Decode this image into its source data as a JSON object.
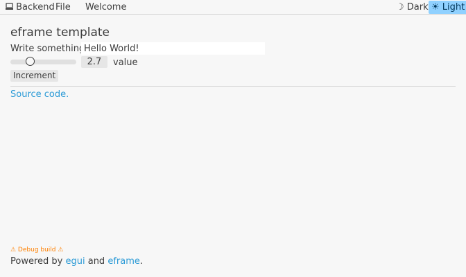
{
  "menu": {
    "backend_icon": "computer-icon",
    "backend_icon_glyph": "💻",
    "backend_label": "Backend",
    "file_label": "File",
    "welcome_label": "Welcome"
  },
  "theme": {
    "dark_icon_glyph": "☽",
    "dark_label": "Dark",
    "light_icon_glyph": "☀",
    "light_label": "Light",
    "selected": "Light",
    "selected_color": "#90d1ff"
  },
  "main": {
    "heading": "eframe template",
    "input_label": "Write something:",
    "input_value": "Hello World!",
    "slider_value": 2.7,
    "slider_min": 0,
    "slider_max": 10,
    "drag_value": "2.7",
    "slider_label": "value",
    "increment_label": "Increment",
    "source_link": "Source code."
  },
  "footer": {
    "debug_warning": "⚠ Debug build ⚠",
    "powered_by": "Powered by ",
    "egui_link": "egui",
    "and_text": " and ",
    "eframe_link": "eframe",
    "period": ".",
    "link_color": "#2a9ad6",
    "warning_color": "#ff8000"
  }
}
